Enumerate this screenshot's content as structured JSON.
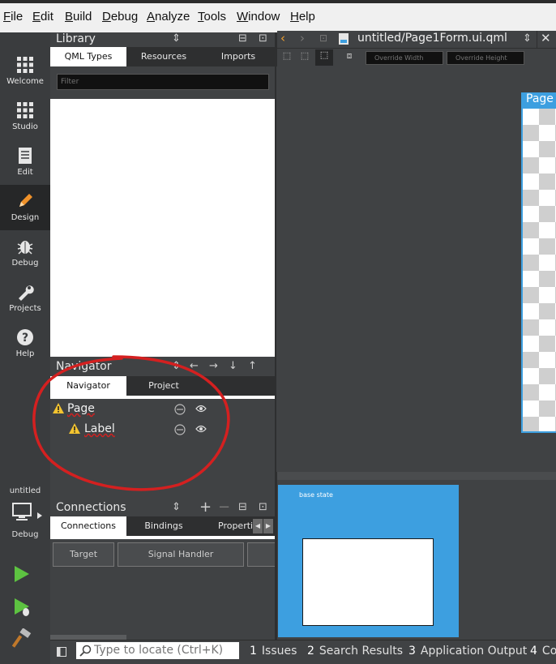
{
  "menu": [
    "File",
    "Edit",
    "Build",
    "Debug",
    "Analyze",
    "Tools",
    "Window",
    "Help"
  ],
  "modes": [
    {
      "label": "Welcome",
      "icon": "grid-icon"
    },
    {
      "label": "Studio",
      "icon": "grid-icon"
    },
    {
      "label": "Edit",
      "icon": "document-icon"
    },
    {
      "label": "Design",
      "icon": "pencil-icon"
    },
    {
      "label": "Debug",
      "icon": "bug-icon"
    },
    {
      "label": "Projects",
      "icon": "wrench-icon"
    },
    {
      "label": "Help",
      "icon": "help-icon"
    }
  ],
  "kit": {
    "project": "untitled",
    "config": "Debug"
  },
  "library": {
    "title": "Library",
    "tabs": [
      "QML Types",
      "Resources",
      "Imports"
    ],
    "filter_placeholder": "Filter"
  },
  "navigator": {
    "title": "Navigator",
    "tabs": [
      "Navigator",
      "Project"
    ],
    "items": [
      {
        "label": "Page",
        "warning": true
      },
      {
        "label": "Label",
        "warning": true
      }
    ]
  },
  "connections": {
    "title": "Connections",
    "tabs": [
      "Connections",
      "Bindings",
      "Properti"
    ],
    "columns": [
      "Target",
      "Signal Handler"
    ]
  },
  "editor": {
    "file": "untitled/Page1Form.ui.qml",
    "override_width": "Override Width",
    "override_height": "Override Height",
    "page_label": "Page"
  },
  "states": {
    "label": "base state"
  },
  "statusbar": {
    "locate_placeholder": "Type to locate (Ctrl+K)",
    "outputs": [
      {
        "num": "1",
        "label": "Issues"
      },
      {
        "num": "2",
        "label": "Search Results"
      },
      {
        "num": "3",
        "label": "Application Output"
      },
      {
        "num": "4",
        "label": "Co"
      }
    ]
  },
  "colors": {
    "accent": "#ff8c00",
    "page_blue": "#3d9fe0",
    "annotation": "#d42020"
  }
}
